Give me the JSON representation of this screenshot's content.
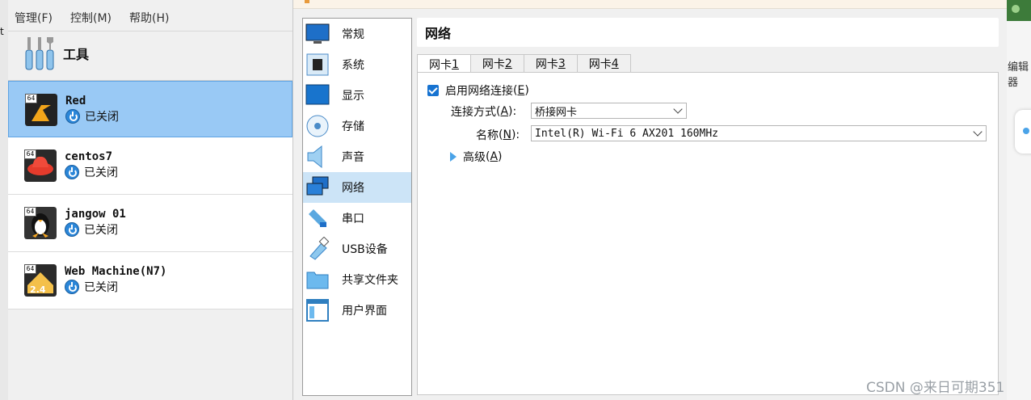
{
  "menu": {
    "items": [
      "管理(F)",
      "控制(M)",
      "帮助(H)"
    ]
  },
  "tools": {
    "label": "工具"
  },
  "left_edge_text": "t",
  "vms": [
    {
      "name": "Red",
      "state": "已关闭",
      "badge": "64",
      "selected": true
    },
    {
      "name": "centos7",
      "state": "已关闭",
      "badge": "64",
      "selected": false
    },
    {
      "name": "jangow 01",
      "state": "已关闭",
      "badge": "64",
      "selected": false
    },
    {
      "name": "Web Machine(N7)",
      "state": "已关闭",
      "badge": "64",
      "selected": false,
      "os_badge": "2.4"
    }
  ],
  "categories": [
    {
      "label": "常规",
      "icon": "monitor-icon"
    },
    {
      "label": "系统",
      "icon": "chip-icon"
    },
    {
      "label": "显示",
      "icon": "display-icon"
    },
    {
      "label": "存储",
      "icon": "disk-icon"
    },
    {
      "label": "声音",
      "icon": "speaker-icon"
    },
    {
      "label": "网络",
      "icon": "network-icon",
      "active": true
    },
    {
      "label": "串口",
      "icon": "serial-icon"
    },
    {
      "label": "USB设备",
      "icon": "usb-icon"
    },
    {
      "label": "共享文件夹",
      "icon": "folder-icon"
    },
    {
      "label": "用户界面",
      "icon": "window-icon"
    }
  ],
  "page": {
    "title": "网络",
    "tabs": [
      {
        "text": "网卡 ",
        "key": "1"
      },
      {
        "text": "网卡 ",
        "key": "2"
      },
      {
        "text": "网卡 ",
        "key": "3"
      },
      {
        "text": "网卡 ",
        "key": "4"
      }
    ],
    "enable": {
      "label": "启用网络连接",
      "accel": "E",
      "checked": true
    },
    "attach": {
      "label": "连接方式",
      "accel": "A",
      "value": "桥接网卡"
    },
    "name": {
      "label": "名称",
      "accel": "N",
      "value": "Intel(R) Wi-Fi 6 AX201 160MHz"
    },
    "advanced": {
      "label": "高级",
      "accel": "A"
    }
  },
  "right_edge_text": "编辑器",
  "watermark": "CSDN @来日可期351",
  "colors": {
    "selection": "#99c9f5",
    "accent": "#1773d1",
    "active_category": "#cce4f7"
  }
}
